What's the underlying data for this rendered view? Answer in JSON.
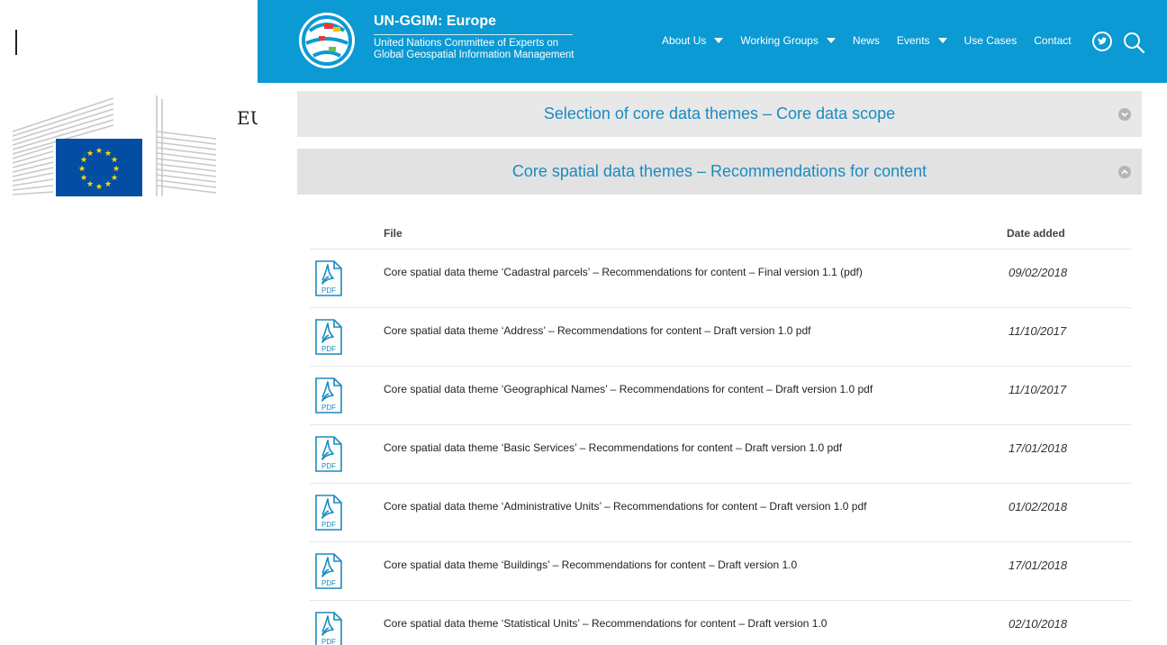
{
  "eu_sidebar": {
    "text": "EU"
  },
  "header": {
    "title": "UN-GGIM: Europe",
    "subtitle_line1": "United Nations Committee of Experts on",
    "subtitle_line2": "Global Geospatial Information Management",
    "nav": [
      {
        "label": "About Us",
        "dropdown": true
      },
      {
        "label": "Working Groups",
        "dropdown": true
      },
      {
        "label": "News",
        "dropdown": false
      },
      {
        "label": "Events",
        "dropdown": true
      },
      {
        "label": "Use Cases",
        "dropdown": false
      },
      {
        "label": "Contact",
        "dropdown": false
      }
    ],
    "icons": [
      "twitter-icon",
      "search-icon"
    ],
    "colors": {
      "header_bg": "#0b9ad3",
      "accent_text": "#1a8bc0"
    }
  },
  "accordion": [
    {
      "title": "Selection of core data themes – Core data scope",
      "state": "collapsed"
    },
    {
      "title": "Core spatial data themes – Recommendations for content",
      "state": "expanded"
    }
  ],
  "files_table": {
    "columns": {
      "file": "File",
      "date": "Date added"
    },
    "rows": [
      {
        "name": "Core spatial data theme ‘Cadastral parcels’ – Recommendations for content – Final version 1.1 (pdf)",
        "date": "09/02/2018"
      },
      {
        "name": "Core spatial data theme ‘Address’ – Recommendations for content – Draft version 1.0 pdf",
        "date": "11/10/2017"
      },
      {
        "name": "Core spatial data theme ‘Geographical Names’ – Recommendations for content – Draft version 1.0 pdf",
        "date": "11/10/2017"
      },
      {
        "name": "Core spatial data theme ‘Basic Services’ – Recommendations for content – Draft version 1.0 pdf",
        "date": "17/01/2018"
      },
      {
        "name": "Core spatial data theme ‘Administrative Units’ – Recommendations for content – Draft version 1.0 pdf",
        "date": "01/02/2018"
      },
      {
        "name": "Core spatial data theme ‘Buildings’ – Recommendations for content – Draft version 1.0",
        "date": "17/01/2018"
      },
      {
        "name": "Core spatial data theme ‘Statistical Units’ – Recommendations for content – Draft version 1.0",
        "date": "02/10/2018"
      }
    ],
    "file_icon": "pdf-icon",
    "pdf_icon_label": "PDF"
  }
}
